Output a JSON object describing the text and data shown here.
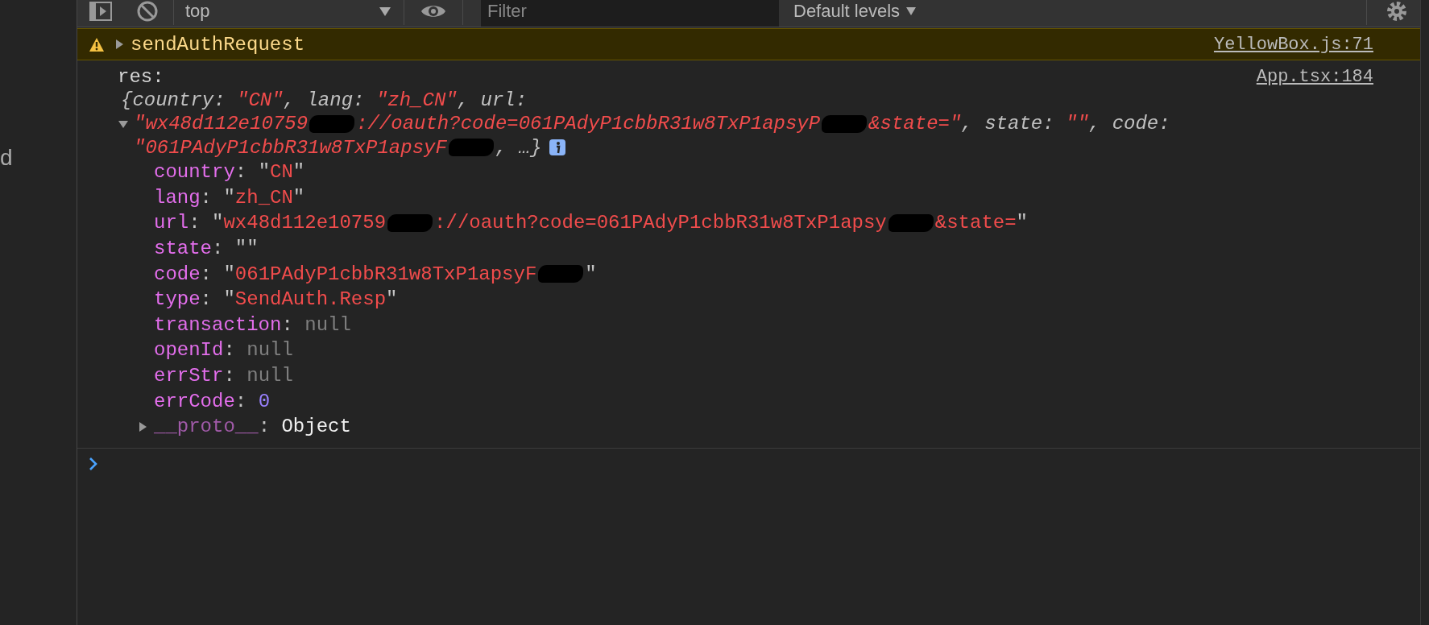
{
  "side_panel": {
    "text": "d"
  },
  "toolbar": {
    "context": "top",
    "filter_placeholder": "Filter",
    "levels": "Default levels"
  },
  "messages": [
    {
      "kind": "warning",
      "expanded": false,
      "text": "sendAuthRequest",
      "source": "YellowBox.js:71"
    },
    {
      "kind": "log",
      "label": "res:",
      "source": "App.tsx:184",
      "expanded": true,
      "preview": [
        [
          {
            "kind": "punct",
            "text": "{"
          },
          {
            "kind": "key",
            "text": "country"
          },
          {
            "kind": "punct",
            "text": ": "
          },
          {
            "kind": "string",
            "text": "\"CN\""
          },
          {
            "kind": "punct",
            "text": ", "
          },
          {
            "kind": "key",
            "text": "lang"
          },
          {
            "kind": "punct",
            "text": ": "
          },
          {
            "kind": "string",
            "text": "\"zh_CN\""
          },
          {
            "kind": "punct",
            "text": ", "
          },
          {
            "kind": "key",
            "text": "url"
          },
          {
            "kind": "punct",
            "text": ":"
          }
        ],
        [
          {
            "kind": "string",
            "text": "\"wx48d112e10759"
          },
          {
            "kind": "redacted"
          },
          {
            "kind": "string",
            "text": "://oauth?code=061PAdyP1cbbR31w8TxP1apsyP"
          },
          {
            "kind": "redacted"
          },
          {
            "kind": "string",
            "text": "&state=\""
          },
          {
            "kind": "punct",
            "text": ", "
          },
          {
            "kind": "key",
            "text": "state"
          },
          {
            "kind": "punct",
            "text": ": "
          },
          {
            "kind": "string",
            "text": "\"\""
          },
          {
            "kind": "punct",
            "text": ", "
          },
          {
            "kind": "key",
            "text": "code"
          },
          {
            "kind": "punct",
            "text": ":"
          }
        ],
        [
          {
            "kind": "string",
            "text": "\"061PAdyP1cbbR31w8TxP1apsyF"
          },
          {
            "kind": "redacted"
          },
          {
            "kind": "punct",
            "text": ", …}"
          },
          {
            "kind": "info"
          }
        ]
      ],
      "properties": [
        {
          "name": "country",
          "value": [
            {
              "kind": "punct",
              "text": ": \""
            },
            {
              "kind": "string",
              "text": "CN"
            },
            {
              "kind": "punct",
              "text": "\""
            }
          ]
        },
        {
          "name": "lang",
          "value": [
            {
              "kind": "punct",
              "text": ": \""
            },
            {
              "kind": "string",
              "text": "zh_CN"
            },
            {
              "kind": "punct",
              "text": "\""
            }
          ]
        },
        {
          "name": "url",
          "value": [
            {
              "kind": "punct",
              "text": ": \""
            },
            {
              "kind": "string",
              "text": "wx48d112e10759"
            },
            {
              "kind": "redacted"
            },
            {
              "kind": "string",
              "text": "://oauth?code=061PAdyP1cbbR31w8TxP1apsy"
            },
            {
              "kind": "redacted"
            },
            {
              "kind": "string",
              "text": "&state="
            },
            {
              "kind": "punct",
              "text": "\""
            }
          ]
        },
        {
          "name": "state",
          "value": [
            {
              "kind": "punct",
              "text": ": \"\""
            }
          ]
        },
        {
          "name": "code",
          "value": [
            {
              "kind": "punct",
              "text": ": \""
            },
            {
              "kind": "string",
              "text": "061PAdyP1cbbR31w8TxP1apsyF"
            },
            {
              "kind": "redacted"
            },
            {
              "kind": "punct",
              "text": "\""
            }
          ]
        },
        {
          "name": "type",
          "value": [
            {
              "kind": "punct",
              "text": ": \""
            },
            {
              "kind": "string",
              "text": "SendAuth.Resp"
            },
            {
              "kind": "punct",
              "text": "\""
            }
          ]
        },
        {
          "name": "transaction",
          "value": [
            {
              "kind": "punct",
              "text": ": "
            },
            {
              "kind": "null",
              "text": "null"
            }
          ]
        },
        {
          "name": "openId",
          "value": [
            {
              "kind": "punct",
              "text": ": "
            },
            {
              "kind": "null",
              "text": "null"
            }
          ]
        },
        {
          "name": "errStr",
          "value": [
            {
              "kind": "punct",
              "text": ": "
            },
            {
              "kind": "null",
              "text": "null"
            }
          ]
        },
        {
          "name": "errCode",
          "value": [
            {
              "kind": "punct",
              "text": ": "
            },
            {
              "kind": "number",
              "text": "0"
            }
          ]
        }
      ],
      "proto": {
        "name": "__proto__",
        "value": [
          {
            "kind": "punct",
            "text": ": "
          },
          {
            "kind": "object",
            "text": "Object"
          }
        ],
        "expanded": false
      }
    }
  ]
}
